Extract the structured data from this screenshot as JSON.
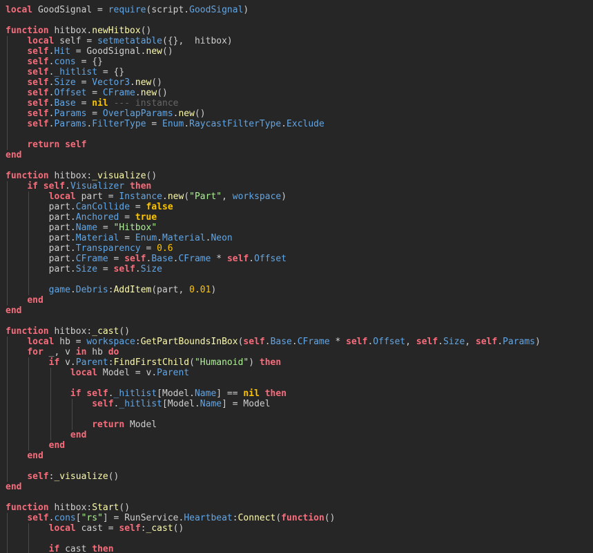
{
  "colors": {
    "background": "#262626",
    "plain": "#cfcfcf",
    "keyword": "#f86d7c",
    "property": "#61a6e6",
    "builtin": "#61a6e6",
    "func": "#fdfbac",
    "string": "#adf195",
    "number": "#ffc600",
    "literal": "#ffc600",
    "comment": "#666666",
    "guide": "#4a4a4a"
  },
  "lines": [
    {
      "indent": 0,
      "tokens": [
        [
          "keyword",
          "local"
        ],
        [
          "plain",
          " GoodSignal = "
        ],
        [
          "builtin",
          "require"
        ],
        [
          "plain",
          "(script."
        ],
        [
          "property",
          "GoodSignal"
        ],
        [
          "plain",
          ")"
        ]
      ]
    },
    {
      "indent": 0,
      "tokens": []
    },
    {
      "indent": 0,
      "tokens": [
        [
          "keyword",
          "function"
        ],
        [
          "plain",
          " hitbox."
        ],
        [
          "func",
          "newHitbox"
        ],
        [
          "plain",
          "()"
        ]
      ]
    },
    {
      "indent": 1,
      "tokens": [
        [
          "plain",
          "    "
        ],
        [
          "keyword",
          "local"
        ],
        [
          "plain",
          " self = "
        ],
        [
          "builtin",
          "setmetatable"
        ],
        [
          "plain",
          "({},  hitbox)"
        ]
      ]
    },
    {
      "indent": 1,
      "tokens": [
        [
          "plain",
          "    "
        ],
        [
          "keyword",
          "self"
        ],
        [
          "plain",
          "."
        ],
        [
          "property",
          "Hit"
        ],
        [
          "plain",
          " = GoodSignal."
        ],
        [
          "func",
          "new"
        ],
        [
          "plain",
          "()"
        ]
      ]
    },
    {
      "indent": 1,
      "tokens": [
        [
          "plain",
          "    "
        ],
        [
          "keyword",
          "self"
        ],
        [
          "plain",
          "."
        ],
        [
          "property",
          "cons"
        ],
        [
          "plain",
          " = {}"
        ]
      ]
    },
    {
      "indent": 1,
      "tokens": [
        [
          "plain",
          "    "
        ],
        [
          "keyword",
          "self"
        ],
        [
          "plain",
          "."
        ],
        [
          "property",
          "_hitlist"
        ],
        [
          "plain",
          " = {}"
        ]
      ]
    },
    {
      "indent": 1,
      "tokens": [
        [
          "plain",
          "    "
        ],
        [
          "keyword",
          "self"
        ],
        [
          "plain",
          "."
        ],
        [
          "property",
          "Size"
        ],
        [
          "plain",
          " = "
        ],
        [
          "builtin",
          "Vector3"
        ],
        [
          "plain",
          "."
        ],
        [
          "func",
          "new"
        ],
        [
          "plain",
          "()"
        ]
      ]
    },
    {
      "indent": 1,
      "tokens": [
        [
          "plain",
          "    "
        ],
        [
          "keyword",
          "self"
        ],
        [
          "plain",
          "."
        ],
        [
          "property",
          "Offset"
        ],
        [
          "plain",
          " = "
        ],
        [
          "builtin",
          "CFrame"
        ],
        [
          "plain",
          "."
        ],
        [
          "func",
          "new"
        ],
        [
          "plain",
          "()"
        ]
      ]
    },
    {
      "indent": 1,
      "tokens": [
        [
          "plain",
          "    "
        ],
        [
          "keyword",
          "self"
        ],
        [
          "plain",
          "."
        ],
        [
          "property",
          "Base"
        ],
        [
          "plain",
          " = "
        ],
        [
          "literal",
          "nil"
        ],
        [
          "plain",
          " "
        ],
        [
          "comment",
          "--- instance"
        ]
      ]
    },
    {
      "indent": 1,
      "tokens": [
        [
          "plain",
          "    "
        ],
        [
          "keyword",
          "self"
        ],
        [
          "plain",
          "."
        ],
        [
          "property",
          "Params"
        ],
        [
          "plain",
          " = "
        ],
        [
          "builtin",
          "OverlapParams"
        ],
        [
          "plain",
          "."
        ],
        [
          "func",
          "new"
        ],
        [
          "plain",
          "()"
        ]
      ]
    },
    {
      "indent": 1,
      "tokens": [
        [
          "plain",
          "    "
        ],
        [
          "keyword",
          "self"
        ],
        [
          "plain",
          "."
        ],
        [
          "property",
          "Params"
        ],
        [
          "plain",
          "."
        ],
        [
          "property",
          "FilterType"
        ],
        [
          "plain",
          " = "
        ],
        [
          "builtin",
          "Enum"
        ],
        [
          "plain",
          "."
        ],
        [
          "property",
          "RaycastFilterType"
        ],
        [
          "plain",
          "."
        ],
        [
          "property",
          "Exclude"
        ]
      ]
    },
    {
      "indent": 1,
      "tokens": []
    },
    {
      "indent": 1,
      "tokens": [
        [
          "plain",
          "    "
        ],
        [
          "keyword",
          "return"
        ],
        [
          "plain",
          " "
        ],
        [
          "keyword",
          "self"
        ]
      ]
    },
    {
      "indent": 0,
      "tokens": [
        [
          "keyword",
          "end"
        ]
      ]
    },
    {
      "indent": 0,
      "tokens": []
    },
    {
      "indent": 0,
      "tokens": [
        [
          "keyword",
          "function"
        ],
        [
          "plain",
          " hitbox:"
        ],
        [
          "func",
          "_visualize"
        ],
        [
          "plain",
          "()"
        ]
      ]
    },
    {
      "indent": 1,
      "tokens": [
        [
          "plain",
          "    "
        ],
        [
          "keyword",
          "if"
        ],
        [
          "plain",
          " "
        ],
        [
          "keyword",
          "self"
        ],
        [
          "plain",
          "."
        ],
        [
          "property",
          "Visualizer"
        ],
        [
          "plain",
          " "
        ],
        [
          "keyword",
          "then"
        ]
      ]
    },
    {
      "indent": 2,
      "tokens": [
        [
          "plain",
          "        "
        ],
        [
          "keyword",
          "local"
        ],
        [
          "plain",
          " part = "
        ],
        [
          "builtin",
          "Instance"
        ],
        [
          "plain",
          "."
        ],
        [
          "func",
          "new"
        ],
        [
          "plain",
          "("
        ],
        [
          "string",
          "\"Part\""
        ],
        [
          "plain",
          ", "
        ],
        [
          "builtin",
          "workspace"
        ],
        [
          "plain",
          ")"
        ]
      ]
    },
    {
      "indent": 2,
      "tokens": [
        [
          "plain",
          "        part."
        ],
        [
          "property",
          "CanCollide"
        ],
        [
          "plain",
          " = "
        ],
        [
          "literal",
          "false"
        ]
      ]
    },
    {
      "indent": 2,
      "tokens": [
        [
          "plain",
          "        part."
        ],
        [
          "property",
          "Anchored"
        ],
        [
          "plain",
          " = "
        ],
        [
          "literal",
          "true"
        ]
      ]
    },
    {
      "indent": 2,
      "tokens": [
        [
          "plain",
          "        part."
        ],
        [
          "property",
          "Name"
        ],
        [
          "plain",
          " = "
        ],
        [
          "string",
          "\"Hitbox\""
        ]
      ]
    },
    {
      "indent": 2,
      "tokens": [
        [
          "plain",
          "        part."
        ],
        [
          "property",
          "Material"
        ],
        [
          "plain",
          " = "
        ],
        [
          "builtin",
          "Enum"
        ],
        [
          "plain",
          "."
        ],
        [
          "property",
          "Material"
        ],
        [
          "plain",
          "."
        ],
        [
          "property",
          "Neon"
        ]
      ]
    },
    {
      "indent": 2,
      "tokens": [
        [
          "plain",
          "        part."
        ],
        [
          "property",
          "Transparency"
        ],
        [
          "plain",
          " = "
        ],
        [
          "number",
          "0.6"
        ]
      ]
    },
    {
      "indent": 2,
      "tokens": [
        [
          "plain",
          "        part."
        ],
        [
          "property",
          "CFrame"
        ],
        [
          "plain",
          " = "
        ],
        [
          "keyword",
          "self"
        ],
        [
          "plain",
          "."
        ],
        [
          "property",
          "Base"
        ],
        [
          "plain",
          "."
        ],
        [
          "property",
          "CFrame"
        ],
        [
          "plain",
          " * "
        ],
        [
          "keyword",
          "self"
        ],
        [
          "plain",
          "."
        ],
        [
          "property",
          "Offset"
        ]
      ]
    },
    {
      "indent": 2,
      "tokens": [
        [
          "plain",
          "        part."
        ],
        [
          "property",
          "Size"
        ],
        [
          "plain",
          " = "
        ],
        [
          "keyword",
          "self"
        ],
        [
          "plain",
          "."
        ],
        [
          "property",
          "Size"
        ]
      ]
    },
    {
      "indent": 2,
      "tokens": []
    },
    {
      "indent": 2,
      "tokens": [
        [
          "plain",
          "        "
        ],
        [
          "builtin",
          "game"
        ],
        [
          "plain",
          "."
        ],
        [
          "property",
          "Debris"
        ],
        [
          "plain",
          ":"
        ],
        [
          "func",
          "AddItem"
        ],
        [
          "plain",
          "(part, "
        ],
        [
          "number",
          "0.01"
        ],
        [
          "plain",
          ")"
        ]
      ]
    },
    {
      "indent": 1,
      "tokens": [
        [
          "plain",
          "    "
        ],
        [
          "keyword",
          "end"
        ]
      ]
    },
    {
      "indent": 0,
      "tokens": [
        [
          "keyword",
          "end"
        ]
      ]
    },
    {
      "indent": 0,
      "tokens": []
    },
    {
      "indent": 0,
      "tokens": [
        [
          "keyword",
          "function"
        ],
        [
          "plain",
          " hitbox:"
        ],
        [
          "func",
          "_cast"
        ],
        [
          "plain",
          "()"
        ]
      ]
    },
    {
      "indent": 1,
      "tokens": [
        [
          "plain",
          "    "
        ],
        [
          "keyword",
          "local"
        ],
        [
          "plain",
          " hb = "
        ],
        [
          "builtin",
          "workspace"
        ],
        [
          "plain",
          ":"
        ],
        [
          "func",
          "GetPartBoundsInBox"
        ],
        [
          "plain",
          "("
        ],
        [
          "keyword",
          "self"
        ],
        [
          "plain",
          "."
        ],
        [
          "property",
          "Base"
        ],
        [
          "plain",
          "."
        ],
        [
          "property",
          "CFrame"
        ],
        [
          "plain",
          " * "
        ],
        [
          "keyword",
          "self"
        ],
        [
          "plain",
          "."
        ],
        [
          "property",
          "Offset"
        ],
        [
          "plain",
          ", "
        ],
        [
          "keyword",
          "self"
        ],
        [
          "plain",
          "."
        ],
        [
          "property",
          "Size"
        ],
        [
          "plain",
          ", "
        ],
        [
          "keyword",
          "self"
        ],
        [
          "plain",
          "."
        ],
        [
          "property",
          "Params"
        ],
        [
          "plain",
          ")"
        ]
      ]
    },
    {
      "indent": 1,
      "tokens": [
        [
          "plain",
          "    "
        ],
        [
          "keyword",
          "for"
        ],
        [
          "plain",
          " _, v "
        ],
        [
          "keyword",
          "in"
        ],
        [
          "plain",
          " hb "
        ],
        [
          "keyword",
          "do"
        ]
      ]
    },
    {
      "indent": 2,
      "tokens": [
        [
          "plain",
          "        "
        ],
        [
          "keyword",
          "if"
        ],
        [
          "plain",
          " v."
        ],
        [
          "property",
          "Parent"
        ],
        [
          "plain",
          ":"
        ],
        [
          "func",
          "FindFirstChild"
        ],
        [
          "plain",
          "("
        ],
        [
          "string",
          "\"Humanoid\""
        ],
        [
          "plain",
          ") "
        ],
        [
          "keyword",
          "then"
        ]
      ]
    },
    {
      "indent": 3,
      "tokens": [
        [
          "plain",
          "            "
        ],
        [
          "keyword",
          "local"
        ],
        [
          "plain",
          " Model = v."
        ],
        [
          "property",
          "Parent"
        ]
      ]
    },
    {
      "indent": 3,
      "tokens": []
    },
    {
      "indent": 3,
      "tokens": [
        [
          "plain",
          "            "
        ],
        [
          "keyword",
          "if"
        ],
        [
          "plain",
          " "
        ],
        [
          "keyword",
          "self"
        ],
        [
          "plain",
          "."
        ],
        [
          "property",
          "_hitlist"
        ],
        [
          "plain",
          "[Model."
        ],
        [
          "property",
          "Name"
        ],
        [
          "plain",
          "] == "
        ],
        [
          "literal",
          "nil"
        ],
        [
          "plain",
          " "
        ],
        [
          "keyword",
          "then"
        ]
      ]
    },
    {
      "indent": 4,
      "tokens": [
        [
          "plain",
          "                "
        ],
        [
          "keyword",
          "self"
        ],
        [
          "plain",
          "."
        ],
        [
          "property",
          "_hitlist"
        ],
        [
          "plain",
          "[Model."
        ],
        [
          "property",
          "Name"
        ],
        [
          "plain",
          "] = Model"
        ]
      ]
    },
    {
      "indent": 4,
      "tokens": []
    },
    {
      "indent": 4,
      "tokens": [
        [
          "plain",
          "                "
        ],
        [
          "keyword",
          "return"
        ],
        [
          "plain",
          " Model"
        ]
      ]
    },
    {
      "indent": 3,
      "tokens": [
        [
          "plain",
          "            "
        ],
        [
          "keyword",
          "end"
        ]
      ]
    },
    {
      "indent": 2,
      "tokens": [
        [
          "plain",
          "        "
        ],
        [
          "keyword",
          "end"
        ]
      ]
    },
    {
      "indent": 1,
      "tokens": [
        [
          "plain",
          "    "
        ],
        [
          "keyword",
          "end"
        ]
      ]
    },
    {
      "indent": 1,
      "tokens": []
    },
    {
      "indent": 1,
      "tokens": [
        [
          "plain",
          "    "
        ],
        [
          "keyword",
          "self"
        ],
        [
          "plain",
          ":"
        ],
        [
          "func",
          "_visualize"
        ],
        [
          "plain",
          "()"
        ]
      ]
    },
    {
      "indent": 0,
      "tokens": [
        [
          "keyword",
          "end"
        ]
      ]
    },
    {
      "indent": 0,
      "tokens": []
    },
    {
      "indent": 0,
      "tokens": [
        [
          "keyword",
          "function"
        ],
        [
          "plain",
          " hitbox:"
        ],
        [
          "func",
          "Start"
        ],
        [
          "plain",
          "()"
        ]
      ]
    },
    {
      "indent": 1,
      "tokens": [
        [
          "plain",
          "    "
        ],
        [
          "keyword",
          "self"
        ],
        [
          "plain",
          "."
        ],
        [
          "property",
          "cons"
        ],
        [
          "plain",
          "["
        ],
        [
          "string",
          "\"rs\""
        ],
        [
          "plain",
          "] = RunService."
        ],
        [
          "property",
          "Heartbeat"
        ],
        [
          "plain",
          ":"
        ],
        [
          "func",
          "Connect"
        ],
        [
          "plain",
          "("
        ],
        [
          "keyword",
          "function"
        ],
        [
          "plain",
          "()"
        ]
      ]
    },
    {
      "indent": 2,
      "tokens": [
        [
          "plain",
          "        "
        ],
        [
          "keyword",
          "local"
        ],
        [
          "plain",
          " cast = "
        ],
        [
          "keyword",
          "self"
        ],
        [
          "plain",
          ":"
        ],
        [
          "func",
          "_cast"
        ],
        [
          "plain",
          "()"
        ]
      ]
    },
    {
      "indent": 2,
      "tokens": []
    },
    {
      "indent": 2,
      "tokens": [
        [
          "plain",
          "        "
        ],
        [
          "keyword",
          "if"
        ],
        [
          "plain",
          " cast "
        ],
        [
          "keyword",
          "then"
        ]
      ]
    }
  ]
}
